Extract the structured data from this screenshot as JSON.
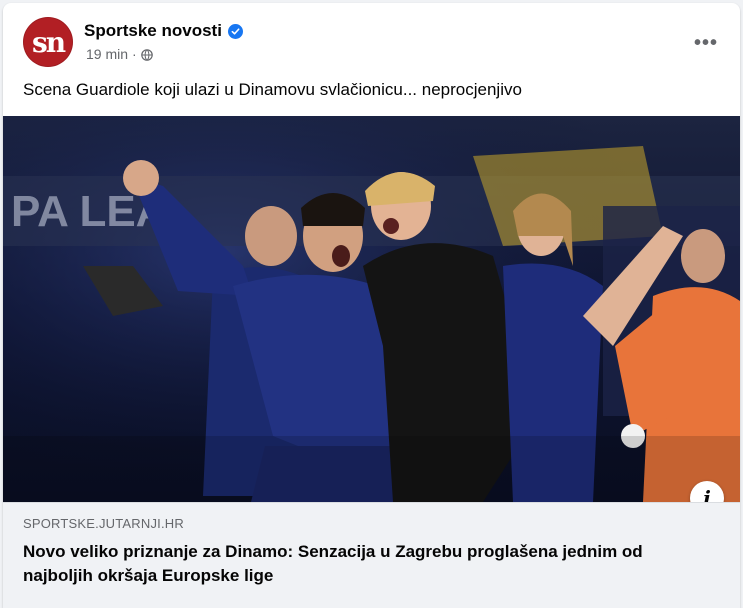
{
  "post": {
    "page": {
      "name": "Sportske novosti",
      "avatar_text": "sn",
      "verified": true
    },
    "meta": {
      "time": "19 min",
      "separator": "·",
      "audience_icon": "globe-icon"
    },
    "more_icon": "more-options-icon",
    "more_label": "•••",
    "text": "Scena Guardiole koji ulazi u Dinamovu svlačionicu... neprocjenjivo",
    "photo": {
      "description_icon": "info-icon",
      "info_label": "i",
      "colors": {
        "jersey": "#1a2a78",
        "goalkeeper": "#e8743a",
        "background": "#0b1233"
      }
    },
    "link": {
      "domain": "SPORTSKE.JUTARNJI.HR",
      "title": "Novo veliko priznanje za Dinamo: Senzacija u Zagrebu proglašena jednim od najboljih okršaja Europske lige"
    }
  },
  "colors": {
    "brand_red": "#b21f24",
    "verified_blue": "#1877f2",
    "secondary_text": "#65676b",
    "link_bg": "#f0f2f5"
  }
}
